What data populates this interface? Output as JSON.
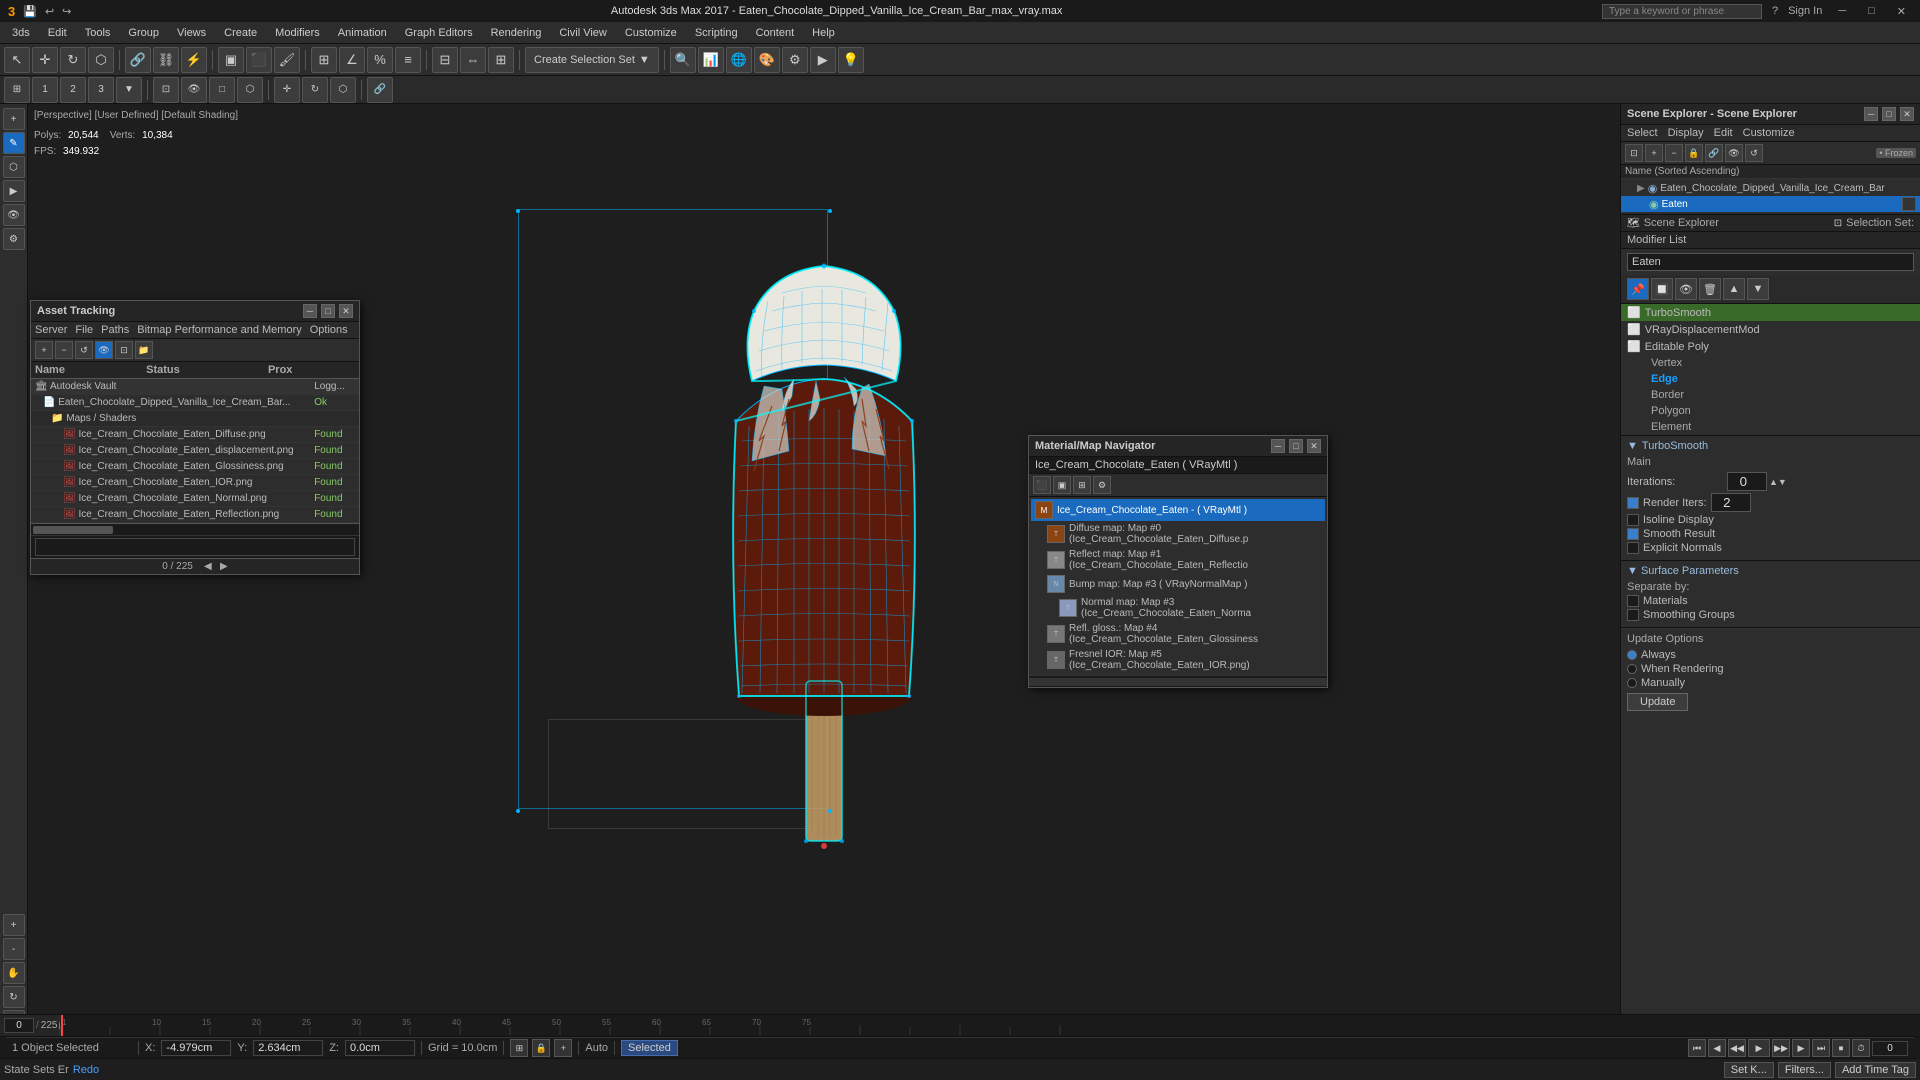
{
  "window": {
    "title": "Autodesk 3ds Max 2017 - Eaten_Chocolate_Dipped_Vanilla_Ice_Cream_Bar_max_vray.max",
    "search_placeholder": "Type a keyword or phrase"
  },
  "menu": {
    "items": [
      "3ds",
      "Edit",
      "Tools",
      "Group",
      "Views",
      "Create",
      "Modifiers",
      "Animation",
      "Graph Editors",
      "Rendering",
      "Civil View",
      "Customize",
      "Scripting",
      "Content",
      "Help"
    ]
  },
  "toolbar1": {
    "create_selection_label": "Create Selection Set",
    "undo_label": "Undo",
    "redo_label": "Redo"
  },
  "viewport": {
    "label": "[Perspective] [User Defined] [Default Shading]",
    "polys_label": "Polys:",
    "polys_value": "20,544",
    "verts_label": "Verts:",
    "verts_value": "10,384",
    "fps_label": "FPS:",
    "fps_value": "349.932"
  },
  "scene_explorer": {
    "title": "Scene Explorer - Scene Explorer",
    "menu_items": [
      "Select",
      "Display",
      "Edit",
      "Customize"
    ],
    "frozen_label": "Frozen",
    "col_name": "Name (Sorted Ascending)",
    "tree": [
      {
        "label": "Eaten_Chocolate_Dipped_Vanilla_Ice_Cream_Bar",
        "indent": 1,
        "icon": "▶",
        "type": "scene-object"
      },
      {
        "label": "Eaten",
        "indent": 2,
        "icon": "●",
        "type": "mesh",
        "selected": true
      }
    ],
    "selection_set_label": "Selection Set:"
  },
  "modifier_list": {
    "title": "Modifier List",
    "name_field_value": "Eaten",
    "items": [
      {
        "label": "TurboSmooth",
        "icon": "⬜",
        "active": true
      },
      {
        "label": "VRayDisplacementMod",
        "icon": "⬜"
      },
      {
        "label": "Editable Poly",
        "icon": "⬜"
      }
    ],
    "sub_items": [
      "Vertex",
      "Edge",
      "Border",
      "Polygon",
      "Element"
    ],
    "icons": [
      "⬛",
      "🔲",
      "🔲",
      "🔲",
      "🔲"
    ]
  },
  "turbosmooth": {
    "title": "TurboSmooth",
    "main_label": "Main",
    "iterations_label": "Iterations:",
    "iterations_value": "0",
    "render_iters_label": "Render Iters:",
    "render_iters_value": "2",
    "isoline_display_label": "Isoline Display",
    "smooth_result_label": "Smooth Result",
    "explicit_normals_label": "Explicit Normals",
    "surface_params_label": "Surface Parameters",
    "separate_by_label": "Separate by:",
    "materials_label": "Materials",
    "smoothing_groups_label": "Smoothing Groups"
  },
  "update_options": {
    "title": "Update Options",
    "always_label": "Always",
    "when_rendering_label": "When Rendering",
    "manually_label": "Manually",
    "update_btn_label": "Update"
  },
  "asset_tracking": {
    "title": "Asset Tracking",
    "menu_items": [
      "Server",
      "File",
      "Paths",
      "Bitmap Performance and Memory",
      "Options"
    ],
    "col_name": "Name",
    "col_status": "Status",
    "col_prox": "Prox",
    "vault_row": "Autodesk Vault",
    "vault_status": "Logg...",
    "file_row": "Eaten_Chocolate_Dipped_Vanilla_Ice_Cream_Bar...",
    "file_status": "Ok",
    "maps_folder": "Maps / Shaders",
    "files": [
      {
        "name": "Ice_Cream_Chocolate_Eaten_Diffuse.png",
        "status": "Found"
      },
      {
        "name": "Ice_Cream_Chocolate_Eaten_displacement.png",
        "status": "Found"
      },
      {
        "name": "Ice_Cream_Chocolate_Eaten_Glossiness.png",
        "status": "Found"
      },
      {
        "name": "Ice_Cream_Chocolate_Eaten_IOR.png",
        "status": "Found"
      },
      {
        "name": "Ice_Cream_Chocolate_Eaten_Normal.png",
        "status": "Found"
      },
      {
        "name": "Ice_Cream_Chocolate_Eaten_Reflection.png",
        "status": "Found"
      }
    ],
    "progress_label": "0 / 225"
  },
  "material_navigator": {
    "title": "Material/Map Navigator",
    "material_name": "Ice_Cream_Chocolate_Eaten  ( VRayMtl )",
    "selected_item": "Ice_Cream_Chocolate_Eaten - ( VRayMtl )",
    "maps": [
      {
        "label": "Diffuse map: Map #0 (Ice_Cream_Chocolate_Eaten_Diffuse.p",
        "color": "#8b4513"
      },
      {
        "label": "Reflect map: Map #1 (Ice_Cream_Chocolate_Eaten_Reflectio",
        "color": "#888"
      },
      {
        "label": "Bump map: Map #3 ( VRayNormalMap )",
        "color": "#6688aa"
      },
      {
        "label": "Normal map: Map #3 (Ice_Cream_Chocolate_Eaten_Norma",
        "color": "#8899bb"
      },
      {
        "label": "Refl. gloss.: Map #4 (Ice_Cream_Chocolate_Eaten_Glossiness",
        "color": "#777"
      },
      {
        "label": "Fresnel IOR: Map #5 (Ice_Cream_Chocolate_Eaten_IOR.png)",
        "color": "#666"
      }
    ]
  },
  "status_bar": {
    "object_selected": "1 Object Selected",
    "x_label": "X:",
    "x_value": "-4.979cm",
    "y_label": "Y:",
    "y_value": "2.634cm",
    "z_label": "Z:",
    "z_value": "0.0cm",
    "grid_label": "Grid = 10.0cm",
    "auto_label": "Auto",
    "selected_label": "Selected",
    "state_sets_label": "State Sets Er",
    "redo_label": "Redo"
  },
  "bottom_bar": {
    "seek_label": "Set K...",
    "filters_label": "Filters...",
    "add_time_tag": "Add Time Tag"
  },
  "icons": {
    "minimize": "─",
    "maximize": "□",
    "close": "✕",
    "arrow_right": "▶",
    "arrow_down": "▼",
    "gear": "⚙",
    "lock": "🔒",
    "eye": "👁",
    "folder": "📁",
    "file": "📄",
    "refresh": "↺",
    "add": "+",
    "remove": "−",
    "nav_first": "⏮",
    "nav_prev": "◀",
    "nav_play": "▶",
    "nav_next": "▶",
    "nav_last": "⏭"
  }
}
